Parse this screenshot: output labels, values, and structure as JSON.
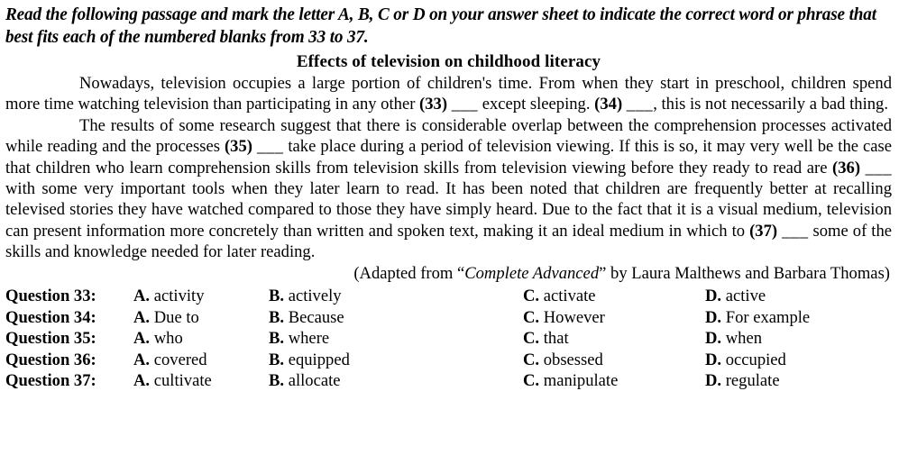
{
  "instruction": "Read the following passage and mark the letter A, B, C or D on your answer sheet to indicate the correct word or phrase that best fits each of the numbered blanks from 33 to  37.",
  "passage_title": "Effects of  television  on childhood literacy",
  "paragraphs": [
    "Nowadays, television occupies a large portion of children's time. From when they start in preschool, children spend more time watching television than participating in any other (33) ___ except sleeping. (34) ___, this is not necessarily a bad thing.",
    "The results of some research suggest that there is considerable overlap between the comprehension processes activated while reading and the processes (35) ___ take place during a period of television viewing. If this is so, it may very well be the case that children who learn comprehension skills from television skills from television viewing before they ready to read are (36) ___ with some very important tools when they later learn to read. It has been noted that children are frequently better at recalling televised stories they have watched compared to those they have simply heard. Due to the fact that it is a visual medium, television can present information more concretely than written and spoken text, making it an ideal medium in which to (37) ___ some of the skills and knowledge needed for later reading."
  ],
  "attribution": {
    "prefix": "(Adapted from “",
    "work_title": "Complete Advanced",
    "suffix": "” by Laura Malthews and Barbara Thomas)"
  },
  "questions": [
    {
      "label": "Question 33:",
      "options": [
        {
          "letter": "A.",
          "text": "activity"
        },
        {
          "letter": "B.",
          "text": "actively"
        },
        {
          "letter": "C.",
          "text": "activate"
        },
        {
          "letter": "D.",
          "text": "active"
        }
      ]
    },
    {
      "label": "Question 34:",
      "options": [
        {
          "letter": "A.",
          "text": "Due to"
        },
        {
          "letter": "B.",
          "text": "Because"
        },
        {
          "letter": "C.",
          "text": "However"
        },
        {
          "letter": "D.",
          "text": "For example"
        }
      ]
    },
    {
      "label": "Question 35:",
      "options": [
        {
          "letter": "A.",
          "text": "who"
        },
        {
          "letter": "B.",
          "text": "where"
        },
        {
          "letter": "C.",
          "text": "that"
        },
        {
          "letter": "D.",
          "text": "when"
        }
      ]
    },
    {
      "label": "Question 36:",
      "options": [
        {
          "letter": "A.",
          "text": "covered"
        },
        {
          "letter": "B.",
          "text": "equipped"
        },
        {
          "letter": "C.",
          "text": "obsessed"
        },
        {
          "letter": "D.",
          "text": "occupied"
        }
      ]
    },
    {
      "label": "Question 37:",
      "options": [
        {
          "letter": "A.",
          "text": "cultivate"
        },
        {
          "letter": "B.",
          "text": "allocate"
        },
        {
          "letter": "C.",
          "text": "manipulate"
        },
        {
          "letter": "D.",
          "text": "regulate"
        }
      ]
    }
  ],
  "colors": {
    "background": "#ffffff",
    "text": "#000000"
  }
}
